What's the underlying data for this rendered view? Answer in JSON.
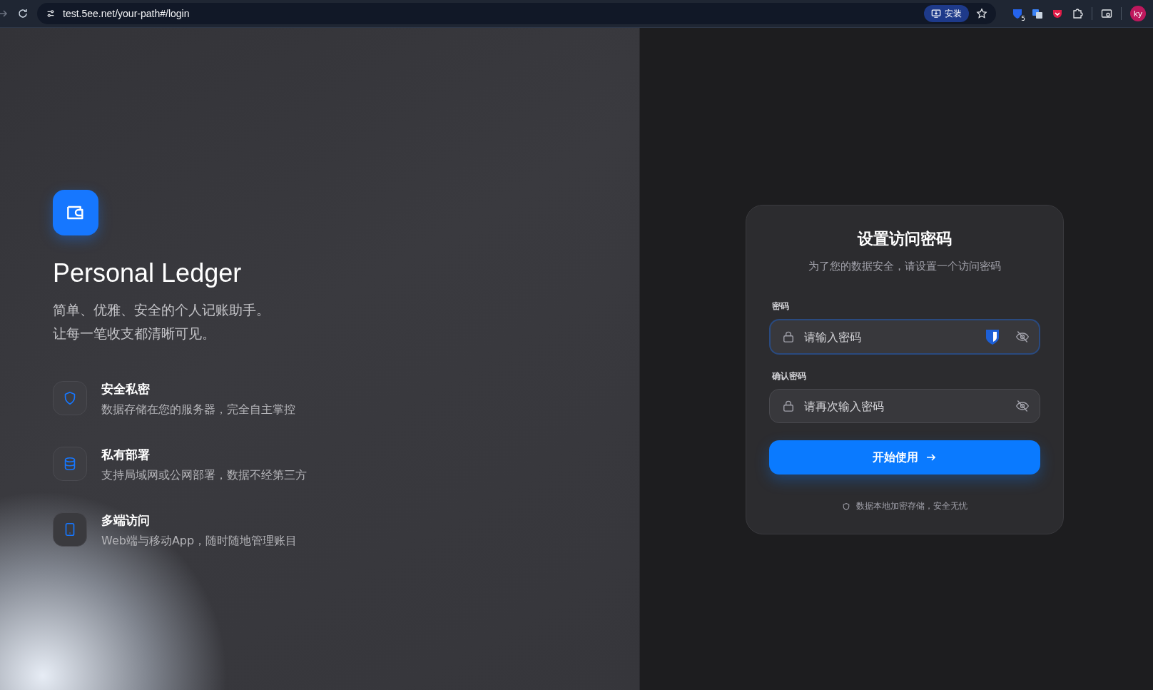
{
  "browser": {
    "url": "test.5ee.net/your-path#/login",
    "install_label": "安装",
    "extension_badge": "5",
    "avatar": "ky"
  },
  "brand": {
    "title": "Personal Ledger",
    "tagline_lines": [
      "简单、优雅、安全的个人记账助手。",
      "让每一笔收支都清晰可见。"
    ]
  },
  "features": [
    {
      "kind": "shield",
      "title": "安全私密",
      "description": "数据存储在您的服务器，完全自主掌控"
    },
    {
      "kind": "database",
      "title": "私有部署",
      "description": "支持局域网或公网部署，数据不经第三方"
    },
    {
      "kind": "phone",
      "title": "多端访问",
      "description": "Web端与移动App，随时随地管理账目"
    }
  ],
  "form": {
    "title": "设置访问密码",
    "subtitle": "为了您的数据安全，请设置一个访问密码",
    "fields": [
      {
        "label": "密码",
        "placeholder": "请输入密码",
        "focused": true
      },
      {
        "label": "确认密码",
        "placeholder": "请再次输入密码",
        "focused": false
      }
    ],
    "submit": "开始使用",
    "note": "数据本地加密存储，安全无忧"
  }
}
